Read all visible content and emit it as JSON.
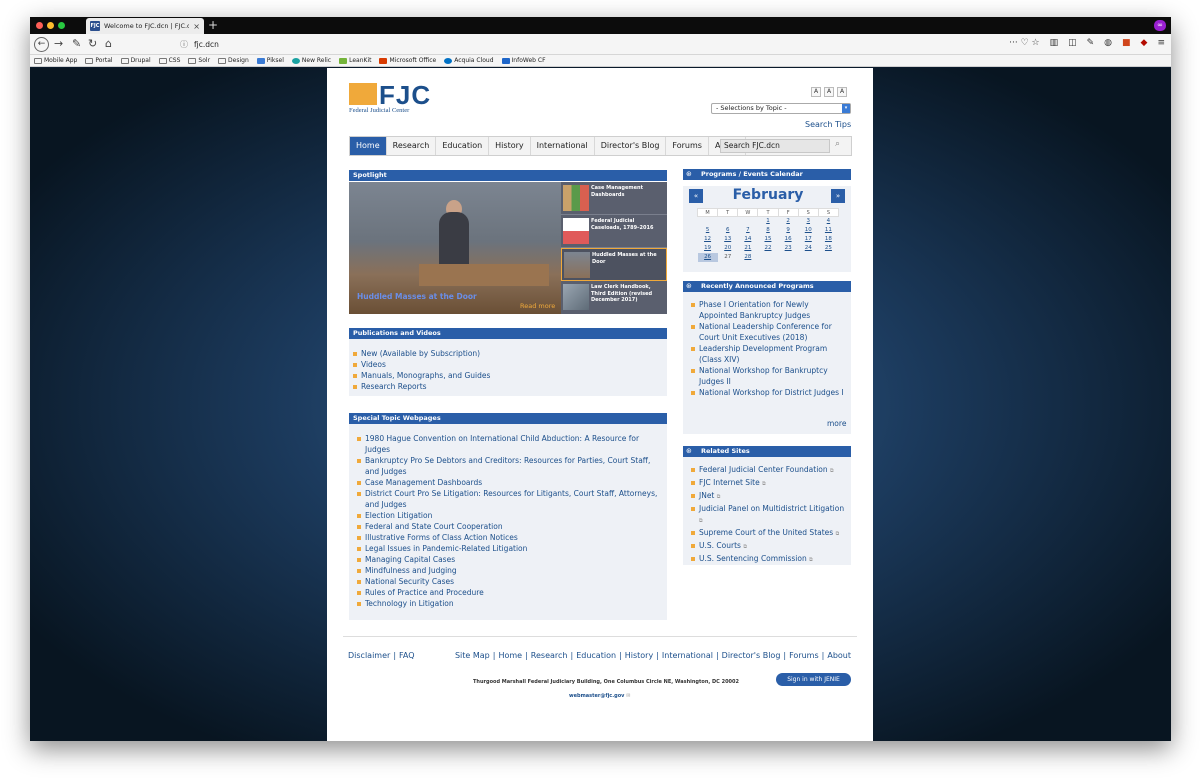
{
  "browser": {
    "tab_title": "Welcome to FJC.dcn | FJC.dcn",
    "favicon_text": "FJC",
    "url": "fjc.dcn",
    "nav_icons": [
      "back-icon",
      "forward-icon",
      "wrench-icon",
      "reload-icon",
      "home-icon"
    ],
    "right_glyphs": "··· ♡ ☆",
    "bookmarks": [
      "Mobile App",
      "Portal",
      "Drupal",
      "CSS",
      "Solr",
      "Design",
      "Piksel",
      "New Relic",
      "LeanKit",
      "Microsoft Office",
      "Acquia Cloud",
      "InfoWeb CF"
    ]
  },
  "site": {
    "logo_text": "FJC",
    "logo_subtitle": "Federal Judicial Center",
    "font_sizes": [
      "A",
      "A",
      "A"
    ],
    "topic_select": "- Selections by Topic -",
    "search_tips": "Search Tips",
    "nav": [
      "Home",
      "Research",
      "Education",
      "History",
      "International",
      "Director's Blog",
      "Forums",
      "About"
    ],
    "search_value": "Search FJC.dcn"
  },
  "spotlight": {
    "title": "Spotlight",
    "caption": "Huddled Masses at the Door",
    "read_more": "Read more",
    "items": [
      "Case Management Dashboards",
      "Federal Judicial Caseloads, 1789–2016",
      "Huddled Masses at the Door",
      "Law Clerk Handbook, Third Edition (revised December 2017)"
    ]
  },
  "publications": {
    "title": "Publications and Videos",
    "items": [
      "New (Available by Subscription)",
      "Videos",
      "Manuals, Monographs, and Guides",
      "Research Reports"
    ]
  },
  "special_topics": {
    "title": "Special Topic Webpages",
    "items": [
      "1980 Hague Convention on International Child Abduction: A Resource for Judges",
      "Bankruptcy Pro Se Debtors and Creditors: Resources for Parties, Court Staff, and Judges",
      "Case Management Dashboards",
      "District Court Pro Se Litigation: Resources for Litigants, Court Staff, Attorneys, and Judges",
      "Election Litigation",
      "Federal and State Court Cooperation",
      "Illustrative Forms of Class Action Notices",
      "Legal Issues in Pandemic-Related Litigation",
      "Managing Capital Cases",
      "Mindfulness and Judging",
      "National Security Cases",
      "Rules of Practice and Procedure",
      "Technology in Litigation"
    ]
  },
  "calendar": {
    "title": "Programs / Events Calendar",
    "month": "February",
    "prev": "«",
    "next": "»",
    "weekdays": [
      "M",
      "T",
      "W",
      "T",
      "F",
      "S",
      "S"
    ],
    "weeks": [
      [
        "",
        "",
        "",
        "1",
        "2",
        "3",
        "4"
      ],
      [
        "5",
        "6",
        "7",
        "8",
        "9",
        "10",
        "11"
      ],
      [
        "12",
        "13",
        "14",
        "15",
        "16",
        "17",
        "18"
      ],
      [
        "19",
        "20",
        "21",
        "22",
        "23",
        "24",
        "25"
      ],
      [
        "26",
        "27",
        "28",
        "",
        "",
        "",
        ""
      ]
    ],
    "today": "26"
  },
  "announced": {
    "title": "Recently Announced Programs",
    "items": [
      "Phase I Orientation for Newly Appointed Bankruptcy Judges",
      "National Leadership Conference for Court Unit Executives (2018)",
      "Leadership Development Program (Class XIV)",
      "National Workshop for Bankruptcy Judges II",
      "National Workshop for District Judges I"
    ],
    "more": "more"
  },
  "related": {
    "title": "Related Sites",
    "items": [
      "Federal Judicial Center Foundation",
      "FJC Internet Site",
      "JNet",
      "Judicial Panel on Multidistrict Litigation",
      "Supreme Court of the United States",
      "U.S. Courts",
      "U.S. Sentencing Commission"
    ]
  },
  "footer": {
    "left_links": [
      "Disclaimer",
      "FAQ"
    ],
    "right_links": [
      "Site Map",
      "Home",
      "Research",
      "Education",
      "History",
      "International",
      "Director's Blog",
      "Forums",
      "About"
    ],
    "address": "Thurgood Marshall Federal Judiciary Building, One Columbus Circle NE, Washington, DC 20002",
    "email": "webmaster@fjc.gov",
    "jenie_button": "Sign in with JENIE"
  },
  "colors": {
    "brand_blue": "#2a5ea8",
    "accent_orange": "#f0a93a"
  }
}
